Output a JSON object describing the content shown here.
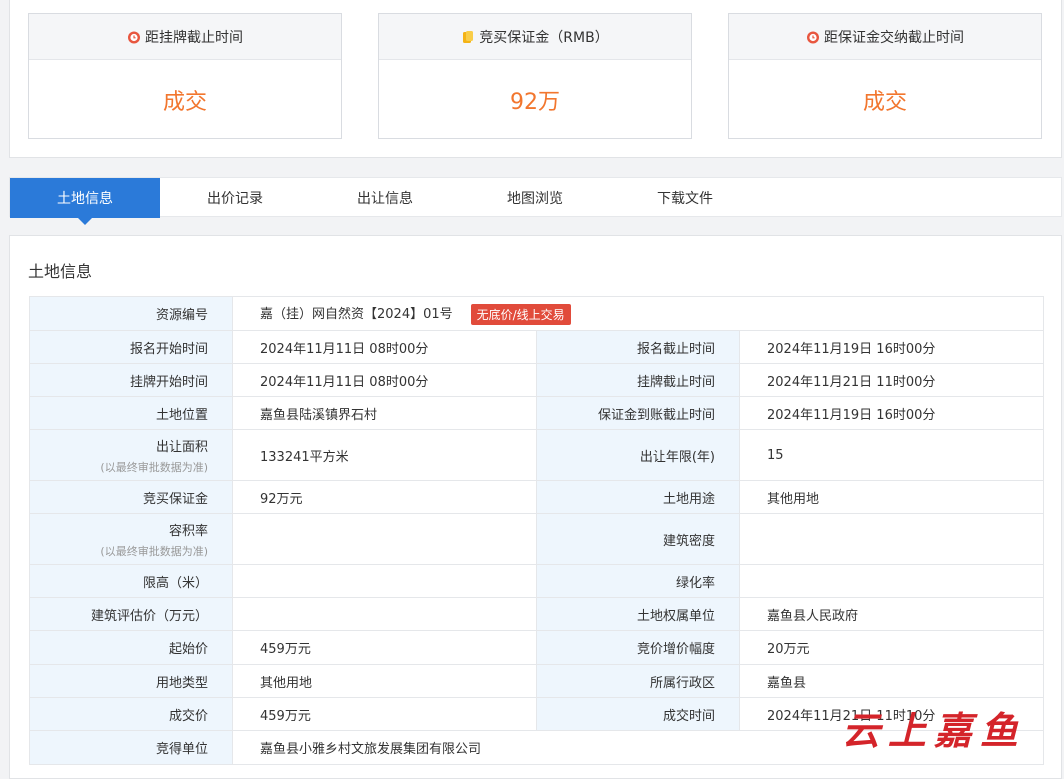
{
  "stats": [
    {
      "label": "距挂牌截止时间",
      "value": "成交",
      "icon": "alarm-clock-icon"
    },
    {
      "label": "竞买保证金（RMB）",
      "value": "92万",
      "icon": "coins-icon"
    },
    {
      "label": "距保证金交纳截止时间",
      "value": "成交",
      "icon": "alarm-clock-icon"
    }
  ],
  "tabs": [
    "土地信息",
    "出价记录",
    "出让信息",
    "地图浏览",
    "下载文件"
  ],
  "section_title": "土地信息",
  "note": "(以最终审批数据为准)",
  "resource": {
    "label": "资源编号",
    "value": "嘉（挂）网自然资【2024】01号",
    "badge": "无底价/线上交易"
  },
  "rows": [
    {
      "l1": "报名开始时间",
      "v1": "2024年11月11日 08时00分",
      "l2": "报名截止时间",
      "v2": "2024年11月19日 16时00分"
    },
    {
      "l1": "挂牌开始时间",
      "v1": "2024年11月11日 08时00分",
      "l2": "挂牌截止时间",
      "v2": "2024年11月21日 11时00分"
    },
    {
      "l1": "土地位置",
      "v1": "嘉鱼县陆溪镇界石村",
      "l2": "保证金到账截止时间",
      "v2": "2024年11月19日 16时00分"
    },
    {
      "l1": "出让面积",
      "v1": "133241平方米",
      "l2": "出让年限(年)",
      "v2": "15"
    },
    {
      "l1": "竞买保证金",
      "v1": "92万元",
      "l2": "土地用途",
      "v2": "其他用地"
    },
    {
      "l1": "容积率",
      "v1": "",
      "l2": "建筑密度",
      "v2": ""
    },
    {
      "l1": "限高（米）",
      "v1": "",
      "l2": "绿化率",
      "v2": ""
    },
    {
      "l1": "建筑评估价（万元）",
      "v1": "",
      "l2": "土地权属单位",
      "v2": "嘉鱼县人民政府"
    },
    {
      "l1": "起始价",
      "v1": "459万元",
      "l2": "竞价增价幅度",
      "v2": "20万元"
    },
    {
      "l1": "用地类型",
      "v1": "其他用地",
      "l2": "所属行政区",
      "v2": "嘉鱼县"
    },
    {
      "l1": "成交价",
      "v1": "459万元",
      "l2": "成交时间",
      "v2": "2024年11月21日 11时10分"
    }
  ],
  "winner": {
    "label": "竞得单位",
    "value": "嘉鱼县小雅乡村文旅发展集团有限公司"
  },
  "watermark": "云上嘉鱼",
  "colors": {
    "accent": "#2b7ad9",
    "value_orange": "#f2762e",
    "badge_red": "#e14b3b",
    "label_bg": "#eef6fd"
  }
}
